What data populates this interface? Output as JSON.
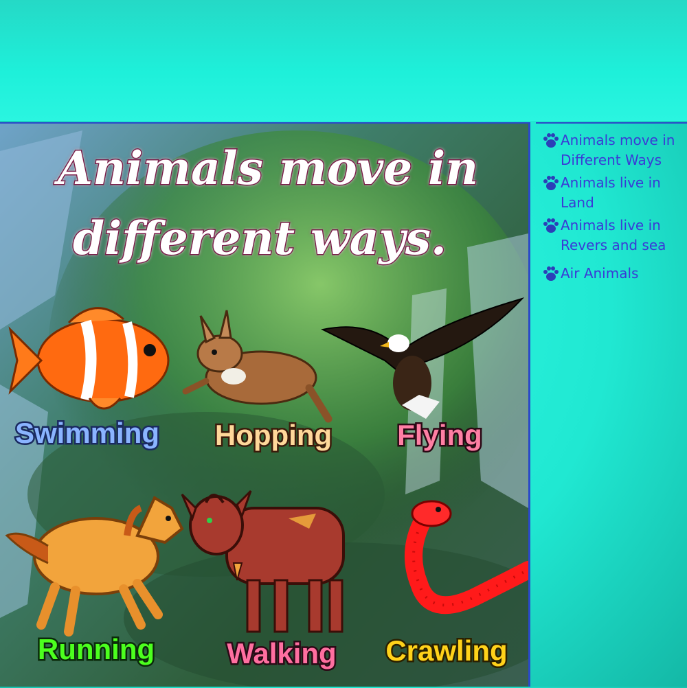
{
  "main": {
    "title_line1": "Animals move in",
    "title_line2": "different ways.",
    "movements": [
      {
        "label": "Swimming",
        "animal": "clownfish",
        "color": "#8ab4ff"
      },
      {
        "label": "Hopping",
        "animal": "rabbit",
        "color": "#ffd89a"
      },
      {
        "label": "Flying",
        "animal": "eagle",
        "color": "#ff7fa4"
      },
      {
        "label": "Running",
        "animal": "horse",
        "color": "#4cff1e"
      },
      {
        "label": "Walking",
        "animal": "cow",
        "color": "#ff6fa0"
      },
      {
        "label": "Crawling",
        "animal": "snake",
        "color": "#ffd21a"
      }
    ]
  },
  "sidebar": {
    "items": [
      {
        "line1": "Animals move in",
        "line2": "Different Ways",
        "icon": "paw-icon"
      },
      {
        "line1": "Animals live in",
        "line2": "Land",
        "icon": "paw-icon"
      },
      {
        "line1": "Animals live in",
        "line2": "Revers and sea",
        "icon": "paw-icon"
      },
      {
        "line1": "Air Animals",
        "line2": "",
        "icon": "paw-icon"
      }
    ],
    "link_color": "#3a3ad6",
    "paw_color": "#2b3fb8"
  },
  "colors": {
    "background": "#1ef0da",
    "border": "#2a49c8"
  }
}
